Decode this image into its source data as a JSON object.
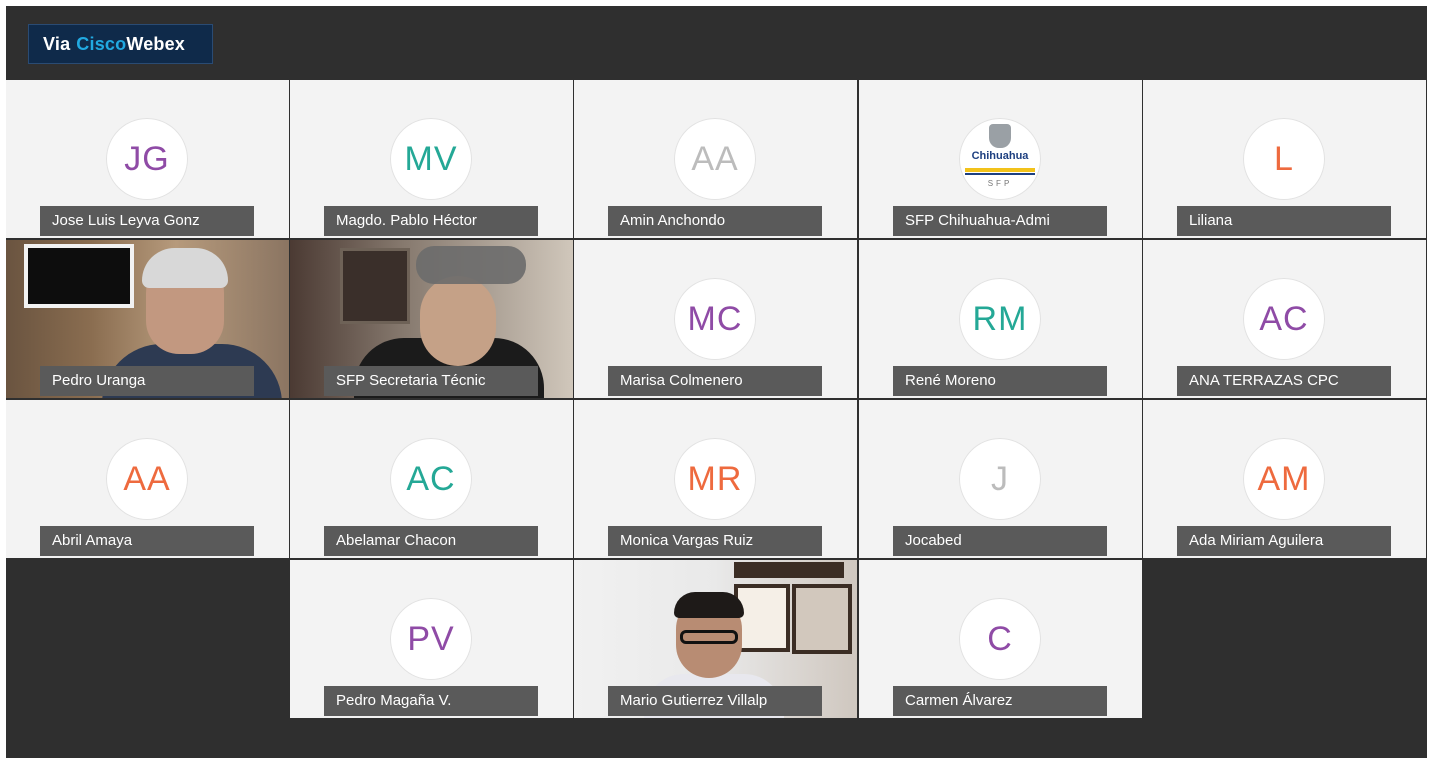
{
  "badge": {
    "via": "Via",
    "cisco": "Cisco",
    "webex": "Webex"
  },
  "participants": [
    {
      "name": "Jose Luis Leyva Gonz",
      "initials": "JG",
      "color": "#8f4ba6",
      "type": "avatar"
    },
    {
      "name": "Magdo. Pablo Héctor",
      "initials": "MV",
      "color": "#24a896",
      "type": "avatar"
    },
    {
      "name": "Amin Anchondo",
      "initials": "AA",
      "color": "#bcbcbc",
      "type": "avatar"
    },
    {
      "name": "SFP Chihuahua-Admi",
      "logo_text": "Chihuahua",
      "logo_sub": "SFP",
      "type": "logo"
    },
    {
      "name": "Liliana",
      "initials": "L",
      "color": "#ee6a3e",
      "type": "avatar"
    },
    {
      "name": "Pedro Uranga",
      "type": "video"
    },
    {
      "name": "SFP Secretaria Técnic",
      "type": "video"
    },
    {
      "name": "Marisa Colmenero",
      "initials": "MC",
      "color": "#8f4ba6",
      "type": "avatar"
    },
    {
      "name": "René Moreno",
      "initials": "RM",
      "color": "#24a896",
      "type": "avatar"
    },
    {
      "name": "ANA TERRAZAS CPC",
      "initials": "AC",
      "color": "#8f4ba6",
      "type": "avatar"
    },
    {
      "name": "Abril Amaya",
      "initials": "AA",
      "color": "#ee6a3e",
      "type": "avatar"
    },
    {
      "name": "Abelamar Chacon",
      "initials": "AC",
      "color": "#24a896",
      "type": "avatar"
    },
    {
      "name": "Monica Vargas Ruiz",
      "initials": "MR",
      "color": "#ee6a3e",
      "type": "avatar"
    },
    {
      "name": "Jocabed",
      "initials": "J",
      "color": "#bcbcbc",
      "type": "avatar"
    },
    {
      "name": "Ada Miriam Aguilera",
      "initials": "AM",
      "color": "#ee6a3e",
      "type": "avatar"
    },
    {
      "name": "Pedro Magaña V.",
      "initials": "PV",
      "color": "#8f4ba6",
      "type": "avatar"
    },
    {
      "name": "Mario Gutierrez Villalp",
      "type": "video"
    },
    {
      "name": "Carmen Álvarez",
      "initials": "C",
      "color": "#8f4ba6",
      "type": "avatar"
    }
  ]
}
